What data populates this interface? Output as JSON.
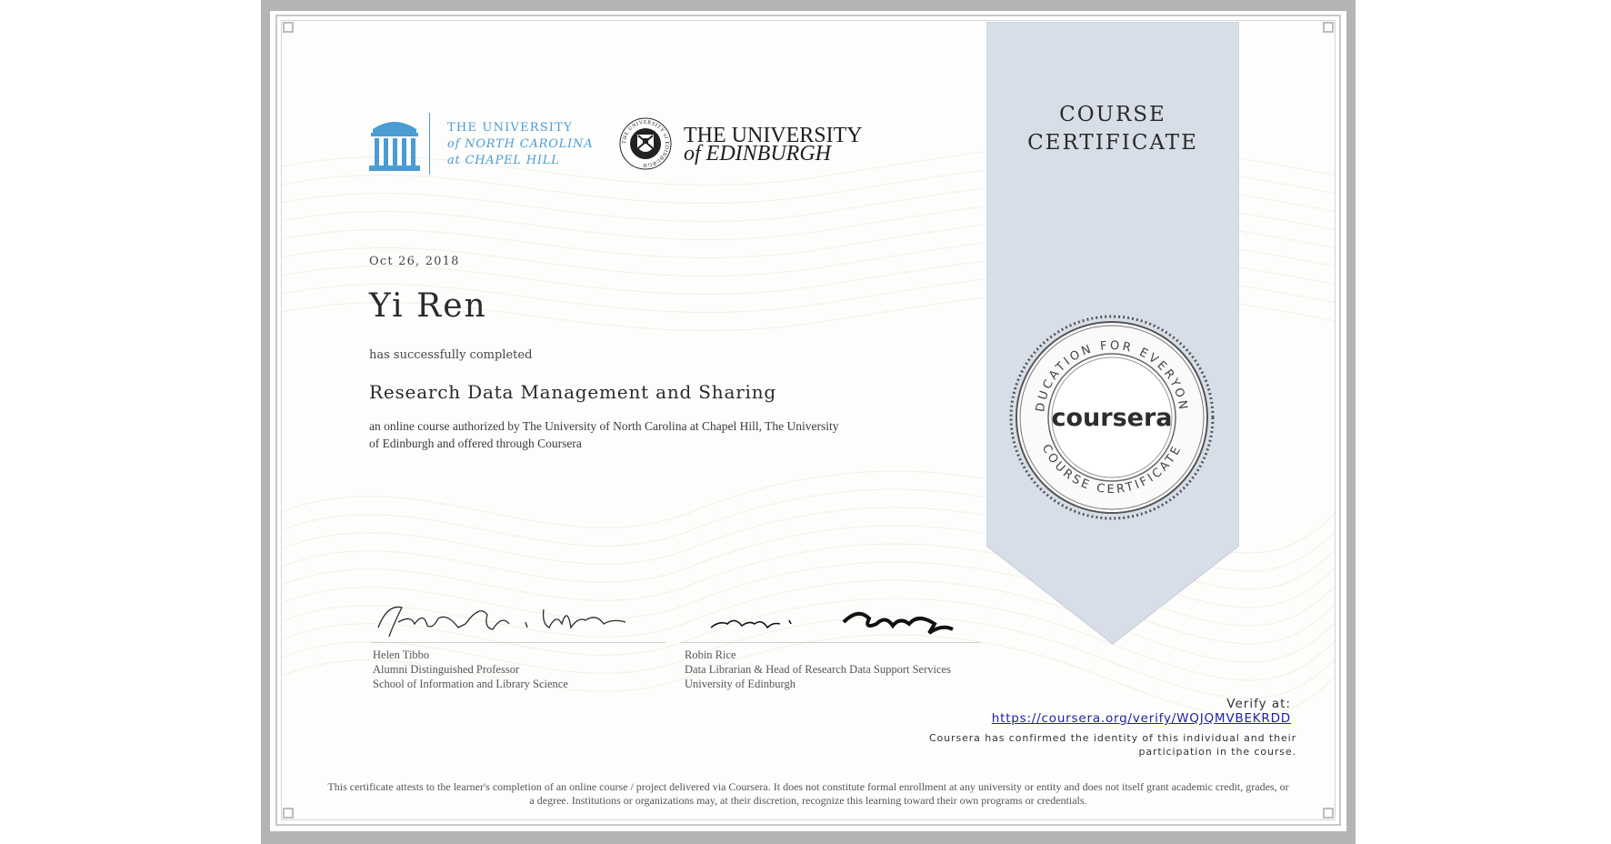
{
  "ribbon": {
    "line1": "COURSE",
    "line2": "CERTIFICATE"
  },
  "logos": {
    "unc": {
      "line1": "THE UNIVERSITY",
      "line2": "of NORTH CAROLINA",
      "line3": "at CHAPEL HILL"
    },
    "edinburgh": {
      "line1": "THE UNIVERSITY",
      "line2": "of EDINBURGH",
      "seal_text": "THE UNIVERSITY of EDINBURGH"
    }
  },
  "certificate": {
    "date": "Oct 26, 2018",
    "recipient": "Yi Ren",
    "completed_text": "has successfully completed",
    "course_title": "Research Data Management and Sharing",
    "authorized_line1": "an online course authorized by The University of North Carolina at Chapel Hill, The University",
    "authorized_line2": "of Edinburgh and offered through Coursera"
  },
  "signatories": [
    {
      "name": "Helen Tibbo",
      "title": "Alumni Distinguished Professor",
      "org": "School of Information and Library Science"
    },
    {
      "name": "Robin Rice",
      "title": "Data Librarian & Head of Research Data Support Services",
      "org": "University of Edinburgh"
    }
  ],
  "seal": {
    "brand": "coursera",
    "top_text": "EDUCATION FOR EVERYONE",
    "bottom_text": "COURSE CERTIFICATE"
  },
  "verify": {
    "label": "Verify at:",
    "url": "https://coursera.org/verify/WQJQMVBEKRDD",
    "confirm_line1": "Coursera has confirmed the identity of this individual and their",
    "confirm_line2": "participation in the course."
  },
  "disclaimer": {
    "line1": "This certificate attests to the learner's completion of an online course / project delivered via Coursera. It does not constitute formal enrollment at any university or entity and does not itself grant academic credit, grades, or",
    "line2": "a degree. Institutions or organizations may, at their discretion, recognize this learning toward their own programs or credentials."
  },
  "colors": {
    "unc_blue": "#4b9cd3",
    "ribbon": "#d7dee8",
    "link": "#1f1fa6",
    "frame": "#b4b4b4"
  }
}
